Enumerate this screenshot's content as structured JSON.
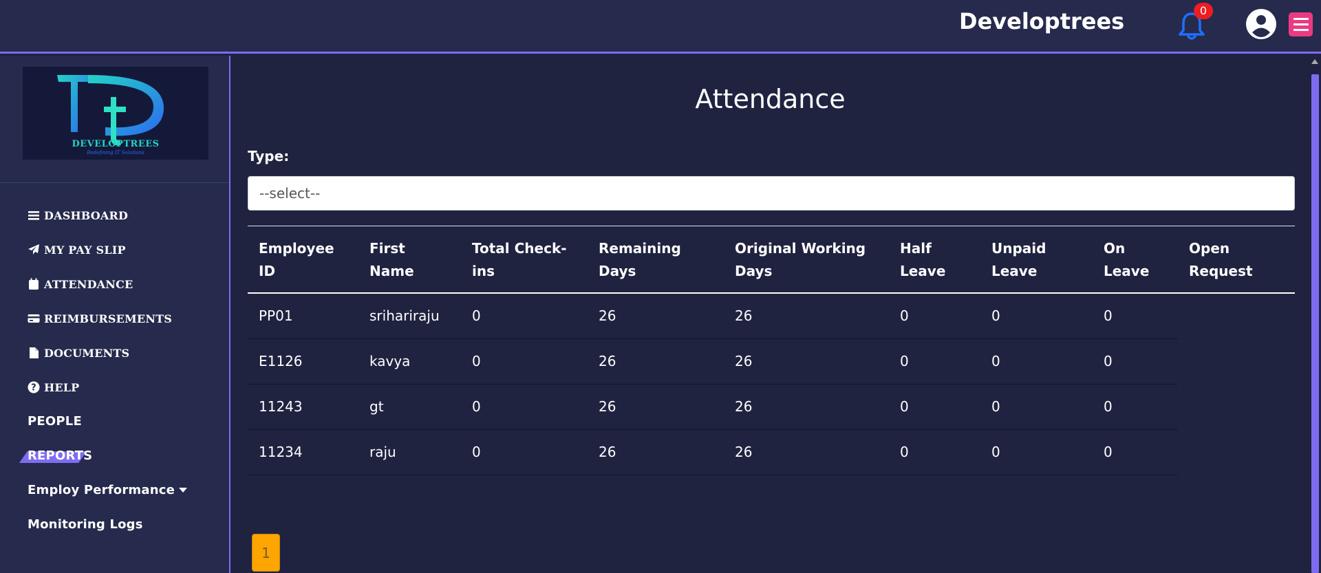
{
  "header": {
    "brand": "Developtrees",
    "notification_count": "0"
  },
  "sidebar": {
    "logo_text": "DEVELOPTREES",
    "logo_tagline": "Redefining IT Solutions",
    "items": [
      {
        "label": "DASHBOARD",
        "icon": "bars-icon"
      },
      {
        "label": "MY PAY SLIP",
        "icon": "paper-plane-icon"
      },
      {
        "label": "ATTENDANCE",
        "icon": "calendar-icon"
      },
      {
        "label": "REIMBURSEMENTS",
        "icon": "credit-card-icon"
      },
      {
        "label": "DOCUMENTS",
        "icon": "file-icon"
      },
      {
        "label": "HELP",
        "icon": "question-circle-icon"
      },
      {
        "label": "PEOPLE"
      },
      {
        "label": "REPORTS"
      },
      {
        "label": "Employ Performance",
        "icon": "caret-down-icon"
      },
      {
        "label": "Monitoring Logs"
      }
    ]
  },
  "main": {
    "title": "Attendance",
    "type_label": "Type:",
    "type_select_value": "--select--",
    "table": {
      "headers": [
        [
          "Employee",
          "ID"
        ],
        [
          "First",
          "Name"
        ],
        [
          "Total Check-",
          "ins"
        ],
        [
          "Remaining",
          "Days"
        ],
        [
          "Original Working",
          "Days"
        ],
        [
          "Half",
          "Leave"
        ],
        [
          "Unpaid",
          "Leave"
        ],
        [
          "On",
          "Leave"
        ],
        [
          "Open",
          "Request"
        ]
      ],
      "rows": [
        [
          "PP01",
          "srihariraju",
          "0",
          "26",
          "26",
          "0",
          "0",
          "0"
        ],
        [
          "E1126",
          "kavya",
          "0",
          "26",
          "26",
          "0",
          "0",
          "0"
        ],
        [
          "11243",
          "gt",
          "0",
          "26",
          "26",
          "0",
          "0",
          "0"
        ],
        [
          "11234",
          "raju",
          "0",
          "26",
          "26",
          "0",
          "0",
          "0"
        ]
      ]
    },
    "pagination": {
      "current_page": "1"
    }
  },
  "colors": {
    "background": "#1f2340",
    "topbar": "#262b4d",
    "accent": "#7e6cf0",
    "menu_button": "#ea3b82",
    "bell": "#1f6fff",
    "badge": "#ee1d23",
    "pager": "#ffa500"
  }
}
